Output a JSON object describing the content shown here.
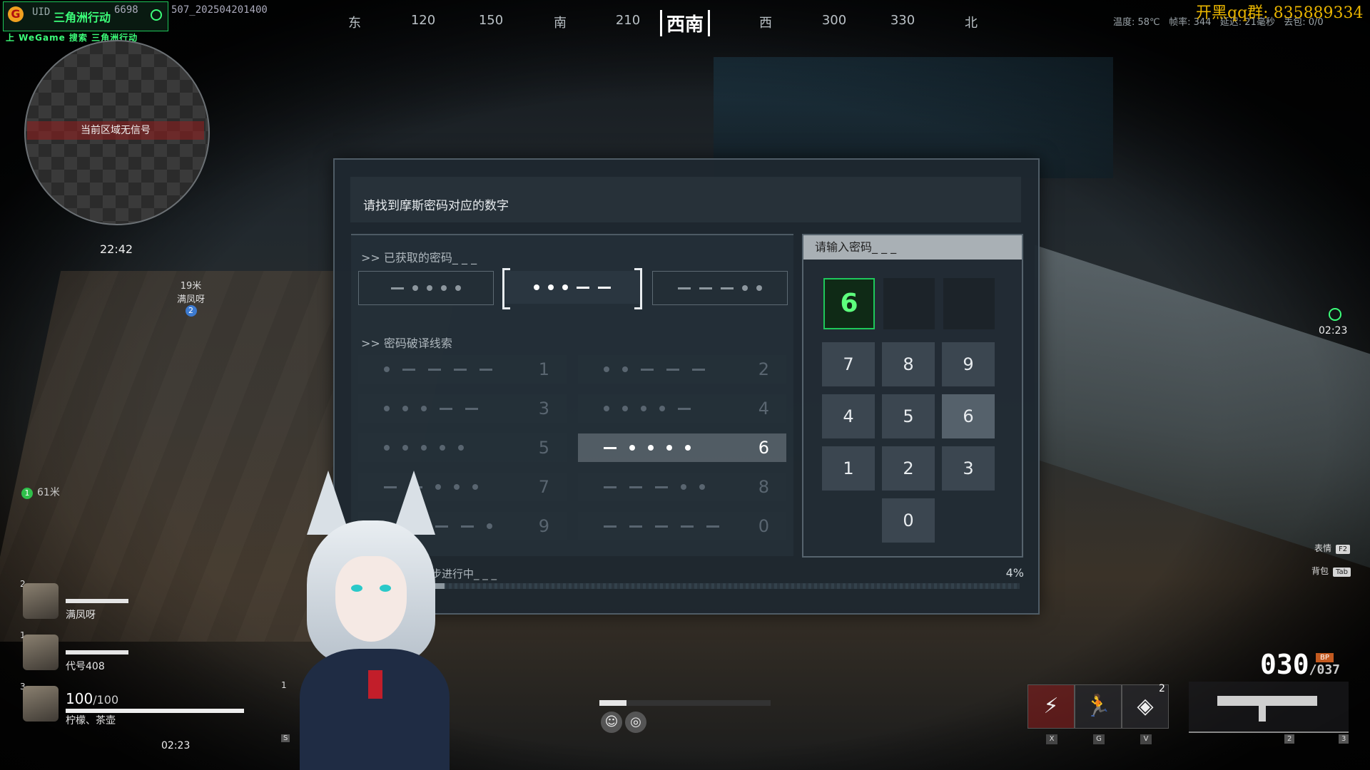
{
  "branding": {
    "uid_prefix": "UID",
    "uid_digits": "6698",
    "uid_suffix": "507_202504201400",
    "game_title": "三角洲行动",
    "wegame_line": "上 WeGame 搜索 三角洲行动",
    "qq_group": "开黑qq群: 835889334"
  },
  "compass": {
    "labels": [
      "东",
      "120",
      "150",
      "南",
      "210",
      "西南",
      "西",
      "300",
      "330",
      "北"
    ],
    "current": "西南"
  },
  "stats": {
    "temp": "温度: 58℃",
    "fps": "帧率: 344",
    "latency": "延迟: 21毫秒",
    "loss": "丢包: 0/0"
  },
  "minimap": {
    "no_signal": "当前区域无信号",
    "time": "22:42"
  },
  "markers": {
    "teammate_distance": "19米",
    "teammate_name": "满凤呀",
    "teammate_num": "2",
    "objective_num": "1",
    "objective_distance": "61米"
  },
  "squad": [
    {
      "num": "2",
      "name": "满凤呀",
      "health": 0.95
    },
    {
      "num": "1",
      "name": "代号408",
      "health": 1.0
    },
    {
      "num": "3",
      "name": "柠檬、茶壶",
      "health": 1.0
    }
  ],
  "player": {
    "hp": "100",
    "hp_max": "/100",
    "timer": "02:23"
  },
  "dialog": {
    "title": "请找到摩斯密码对应的数字",
    "obtained_label": ">> 已获取的密码_ _ _",
    "clues_label": ">> 密码破译线索",
    "input_label": "请输入密码_ _ _",
    "sync_label": "同步进行中_ _ _",
    "progress": "4%",
    "progress_value": 0.04,
    "obtained_codes": [
      {
        "symbols": [
          "dash",
          "dot",
          "dot",
          "dot",
          "dot"
        ],
        "active": false
      },
      {
        "symbols": [
          "dot",
          "dot",
          "dot",
          "dash",
          "dash"
        ],
        "active": true
      },
      {
        "symbols": [
          "dash",
          "dash",
          "dash",
          "dot",
          "dot"
        ],
        "active": false
      }
    ],
    "clues": [
      {
        "symbols": [
          "dot",
          "dash",
          "dash",
          "dash",
          "dash"
        ],
        "digit": "1",
        "highlight": false
      },
      {
        "symbols": [
          "dot",
          "dot",
          "dash",
          "dash",
          "dash"
        ],
        "digit": "2",
        "highlight": false
      },
      {
        "symbols": [
          "dot",
          "dot",
          "dot",
          "dash",
          "dash"
        ],
        "digit": "3",
        "highlight": false
      },
      {
        "symbols": [
          "dot",
          "dot",
          "dot",
          "dot",
          "dash"
        ],
        "digit": "4",
        "highlight": false
      },
      {
        "symbols": [
          "dot",
          "dot",
          "dot",
          "dot",
          "dot"
        ],
        "digit": "5",
        "highlight": false
      },
      {
        "symbols": [
          "dash",
          "dot",
          "dot",
          "dot",
          "dot"
        ],
        "digit": "6",
        "highlight": true
      },
      {
        "symbols": [
          "dash",
          "dash",
          "dot",
          "dot",
          "dot"
        ],
        "digit": "7",
        "highlight": false
      },
      {
        "symbols": [
          "dash",
          "dash",
          "dash",
          "dot",
          "dot"
        ],
        "digit": "8",
        "highlight": false
      },
      {
        "symbols": [
          "dash",
          "dash",
          "dash",
          "dash",
          "dot"
        ],
        "digit": "9",
        "highlight": false
      },
      {
        "symbols": [
          "dash",
          "dash",
          "dash",
          "dash",
          "dash"
        ],
        "digit": "0",
        "highlight": false
      }
    ],
    "entered": [
      "6",
      "",
      ""
    ],
    "keypad": [
      "7",
      "8",
      "9",
      "4",
      "5",
      "6",
      "1",
      "2",
      "3",
      "0"
    ],
    "hovered_key": "6"
  },
  "right_hud": {
    "timer": "02:23",
    "emote_label": "表情",
    "emote_key": "F2",
    "bag_label": "背包",
    "bag_key": "Tab",
    "ammo_mag": "030",
    "ammo_reserve": "/037",
    "bp_badge": "BP",
    "ability_keys": [
      "X",
      "G",
      "V"
    ],
    "ability_count": "2",
    "weapon_slots": [
      "2",
      "3"
    ]
  },
  "bottom_center": {
    "stamina": 0.16
  },
  "left_edge": {
    "marker_num": "1",
    "key_hint": "S"
  }
}
